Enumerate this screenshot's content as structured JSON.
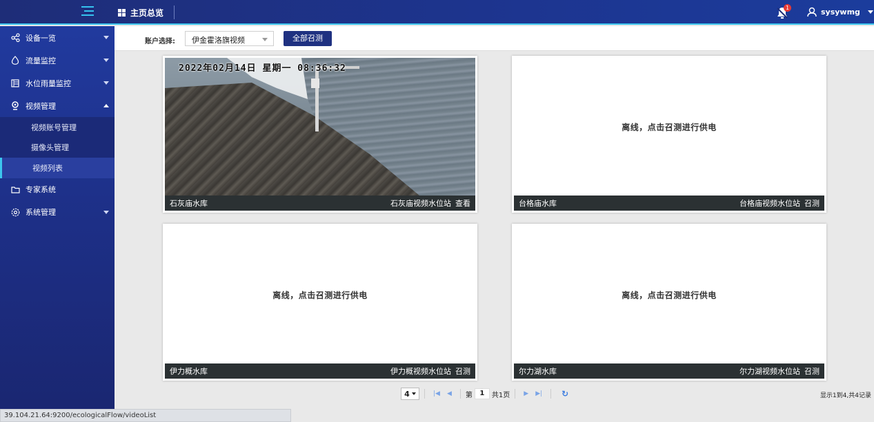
{
  "header": {
    "home_label": "主页总览",
    "notification_count": "1",
    "username": "sysywmg"
  },
  "sidebar": {
    "items": [
      {
        "label": "设备一览",
        "icon": "share-icon"
      },
      {
        "label": "流量监控",
        "icon": "droplet-icon"
      },
      {
        "label": "水位雨量监控",
        "icon": "gauge-icon"
      },
      {
        "label": "视频管理",
        "icon": "location-icon"
      },
      {
        "label": "专家系统",
        "icon": "folder-icon"
      },
      {
        "label": "系统管理",
        "icon": "gear-icon"
      }
    ],
    "video_sub": [
      {
        "label": "视频账号管理"
      },
      {
        "label": "摄像头管理"
      },
      {
        "label": "视频列表"
      }
    ]
  },
  "filter": {
    "label": "账户选择:",
    "selected": "伊金霍洛旗视频",
    "call_all_button": "全部召测"
  },
  "cards": [
    {
      "name": "石灰庙水库",
      "station": "石灰庙视频水位站",
      "action": "查看",
      "status": ""
    },
    {
      "name": "台格庙水库",
      "station": "台格庙视频水位站",
      "action": "召测",
      "status": "离线，点击召测进行供电"
    },
    {
      "name": "伊力概水库",
      "station": "伊力概视频水位站",
      "action": "召测",
      "status": "离线，点击召测进行供电"
    },
    {
      "name": "尔力湖水库",
      "station": "尔力湖视频水位站",
      "action": "召测",
      "status": "离线，点击召测进行供电"
    }
  ],
  "video_osd": {
    "timestamp": "2022年02月14日  星期一 08:36:32"
  },
  "pagination": {
    "page_size": "4",
    "page_prefix": "第",
    "current_page": "1",
    "total_pages": "共1页",
    "record_info": "显示1到4,共4记录"
  },
  "statusbar": {
    "url": "39.104.21.64:9200/ecologicalFlow/videoList"
  },
  "colors": {
    "accent": "#3cc6ee",
    "sidebar": "#1d2f86",
    "button": "#1f3181",
    "footer": "#2b3133"
  }
}
